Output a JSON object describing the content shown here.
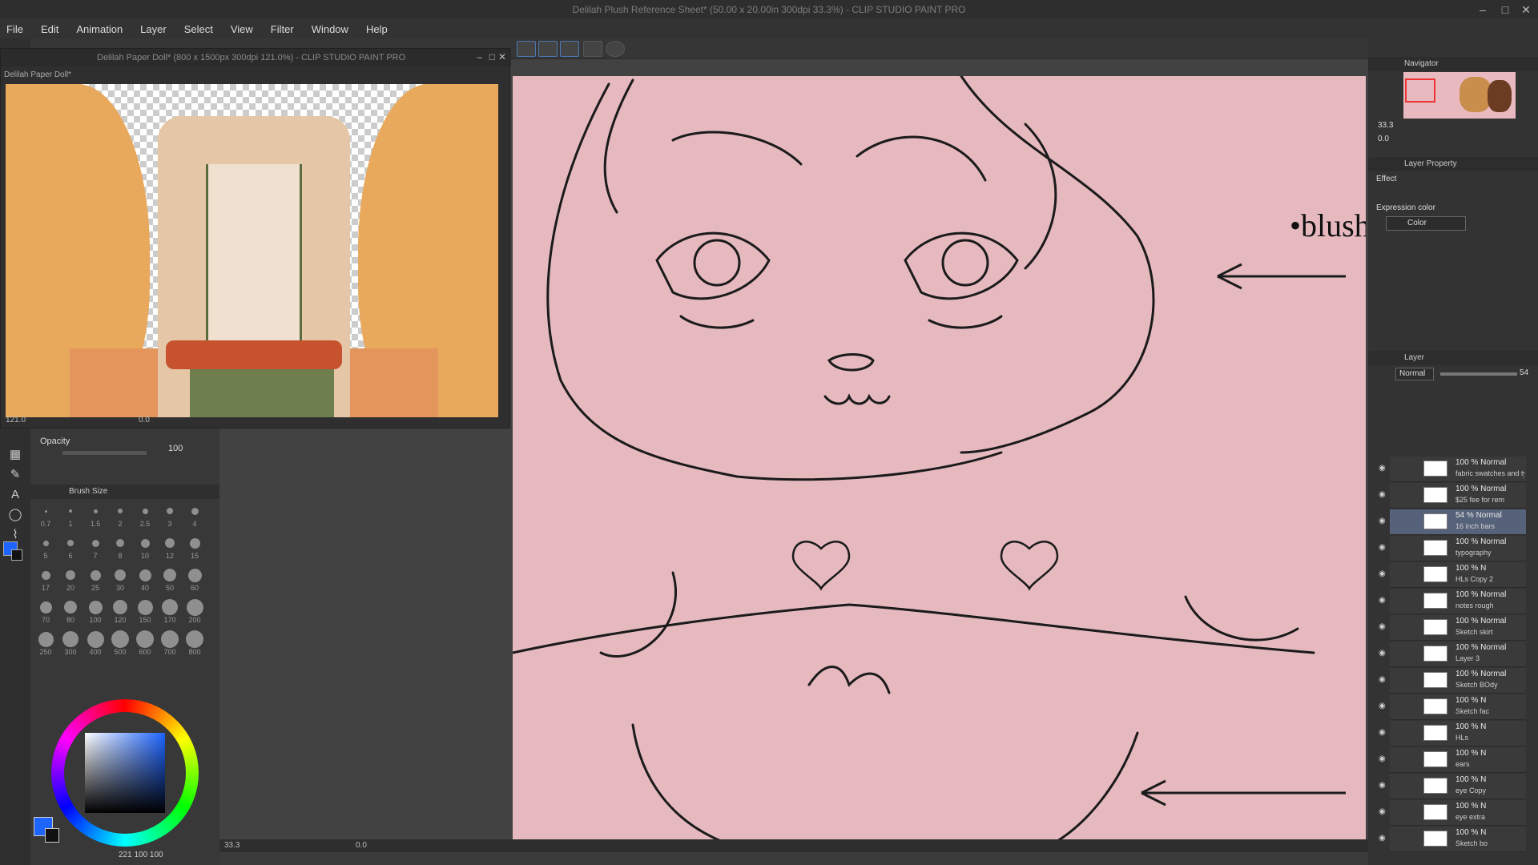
{
  "window": {
    "title": "Delilah Plush Reference Sheet* (50.00 x 20.00in 300dpi 33.3%) - CLIP STUDIO PAINT PRO"
  },
  "menu": [
    "File",
    "Edit",
    "Animation",
    "Layer",
    "Select",
    "View",
    "Filter",
    "Window",
    "Help"
  ],
  "subwindow": {
    "title": "Delilah Paper Doll* (800 x 1500px 300dpi 121.0%) - CLIP STUDIO PAINT PRO",
    "tab": "Delilah Paper Doll*",
    "zoom": "121.0",
    "angle": "0.0"
  },
  "main_canvas": {
    "zoom": "33.3",
    "angle": "0.0",
    "annotation": "•blush"
  },
  "tool_property": {
    "opacity_label": "Opacity",
    "opacity_value": "100"
  },
  "brush_size": {
    "label": "Brush Size",
    "sizes": [
      "0.7",
      "1",
      "1.5",
      "2",
      "2.5",
      "3",
      "4",
      "5",
      "6",
      "7",
      "8",
      "10",
      "12",
      "15",
      "17",
      "20",
      "25",
      "30",
      "40",
      "50",
      "60",
      "70",
      "80",
      "100",
      "120",
      "150",
      "170",
      "200",
      "250",
      "300",
      "400",
      "500",
      "600",
      "700",
      "800"
    ]
  },
  "color": {
    "main": "#1e64ff",
    "sub": "#111111",
    "hsv_readout": "221  100  100"
  },
  "navigator": {
    "label": "Navigator",
    "zoom": "33.3",
    "angle": "0.0"
  },
  "layer_property": {
    "label": "Layer Property",
    "effect_label": "Effect",
    "expression_label": "Expression color",
    "expression_value": "Color"
  },
  "layer_panel": {
    "label": "Layer",
    "blend_mode": "Normal",
    "opacity": "54",
    "layers": [
      {
        "line1": "100 % Normal",
        "line2": "fabric swatches and ty",
        "selected": false
      },
      {
        "line1": "100 % Normal",
        "line2": "$25 fee for rem",
        "selected": false
      },
      {
        "line1": "54 % Normal",
        "line2": "16 inch bars",
        "selected": true
      },
      {
        "line1": "100 % Normal",
        "line2": "typography",
        "selected": false
      },
      {
        "line1": "100 % N",
        "line2": "HLs Copy 2",
        "selected": false
      },
      {
        "line1": "100 % Normal",
        "line2": "notes rough",
        "selected": false
      },
      {
        "line1": "100 % Normal",
        "line2": "Sketch skirt",
        "selected": false
      },
      {
        "line1": "100 % Normal",
        "line2": "Layer 3",
        "selected": false
      },
      {
        "line1": "100 % Normal",
        "line2": "Sketch BOdy",
        "selected": false
      },
      {
        "line1": "100 % N",
        "line2": "Sketch fac",
        "selected": false
      },
      {
        "line1": "100 % N",
        "line2": "HLs",
        "selected": false
      },
      {
        "line1": "100 % N",
        "line2": "ears",
        "selected": false
      },
      {
        "line1": "100 % N",
        "line2": "eye Copy",
        "selected": false
      },
      {
        "line1": "100 % N",
        "line2": "eye extra",
        "selected": false
      },
      {
        "line1": "100 % N",
        "line2": "Sketch bo",
        "selected": false
      }
    ]
  }
}
